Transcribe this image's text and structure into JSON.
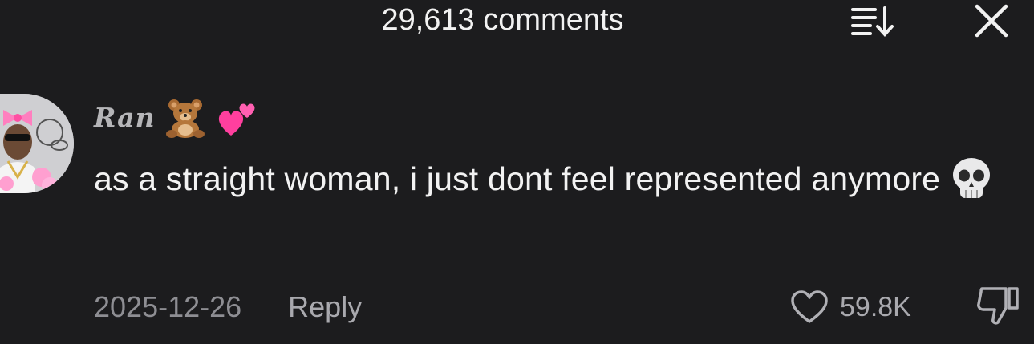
{
  "header": {
    "comment_count": "29,613 comments",
    "sort_icon": "sort-list-icon",
    "close_icon": "close-icon"
  },
  "comment": {
    "username": "Ran",
    "username_emojis": [
      "teddy-bear-icon",
      "two-hearts-icon"
    ],
    "text": "as a straight woman, i just dont feel represented anymore",
    "text_emoji": "skull-icon",
    "date": "2025-12-26",
    "reply_label": "Reply",
    "like_count": "59.8K"
  },
  "colors": {
    "background": "#1c1c1e",
    "primary_text": "#f2f2f2",
    "secondary_text": "#8e8e93",
    "heart_pink": "#ff4fa3"
  }
}
